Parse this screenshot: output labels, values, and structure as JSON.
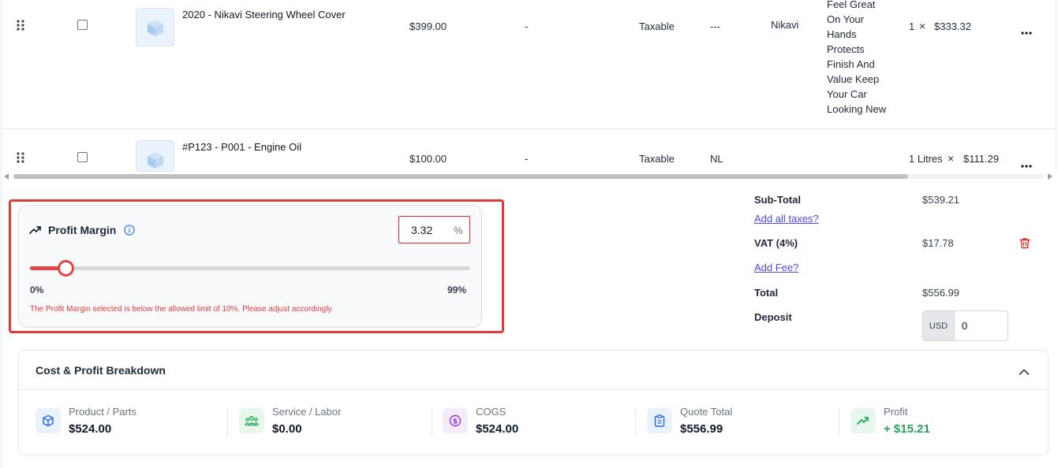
{
  "line_items": [
    {
      "name": "2020 - Nikavi Steering Wheel Cover",
      "price": "$399.00",
      "discount": "-",
      "tax": "Taxable",
      "sku": "---",
      "brand": "Nikavi",
      "description_lines": [
        "Feel Great",
        "On Your",
        "Hands",
        "Protects",
        "Finish And",
        "Value Keep",
        "Your Car",
        "Looking New"
      ],
      "qty": "1",
      "multiply": "×",
      "line_total": "$333.32"
    },
    {
      "name": "#P123 - P001 - Engine Oil",
      "price": "$100.00",
      "discount": "-",
      "tax": "Taxable",
      "sku": "NL",
      "qty": "1 Litres",
      "multiply": "×",
      "line_total": "$111.29"
    }
  ],
  "profit_margin": {
    "title": "Profit Margin",
    "value": "3.32",
    "suffix": "%",
    "slider_value_percent": 3.32,
    "slider_max_percent": 99,
    "min_label": "0%",
    "max_label": "99%",
    "error": "The Profit Margin selected is below the allowed limit of 10%. Please adjust accordingly."
  },
  "summary": {
    "subtotal_label": "Sub-Total",
    "subtotal_value": "$539.21",
    "add_taxes_link": "Add all taxes?",
    "vat_label": "VAT (4%)",
    "vat_value": "$17.78",
    "add_fee_link": "Add Fee?",
    "total_label": "Total",
    "total_value": "$556.99",
    "deposit_label": "Deposit",
    "deposit_currency": "USD",
    "deposit_value": "0"
  },
  "breakdown": {
    "title": "Cost & Profit Breakdown",
    "items": [
      {
        "label": "Product / Parts",
        "value": "$524.00",
        "icon": "cube-icon"
      },
      {
        "label": "Service / Labor",
        "value": "$0.00",
        "icon": "team-icon"
      },
      {
        "label": "COGS",
        "value": "$524.00",
        "icon": "dollar-icon"
      },
      {
        "label": "Quote Total",
        "value": "$556.99",
        "icon": "clipboard-icon"
      },
      {
        "label": "Profit",
        "value": "+ $15.21",
        "icon": "trending-up-icon"
      }
    ]
  },
  "colors": {
    "accent_red": "#dc3b3b",
    "link": "#4f46e5",
    "profit_green": "#22a55a"
  }
}
